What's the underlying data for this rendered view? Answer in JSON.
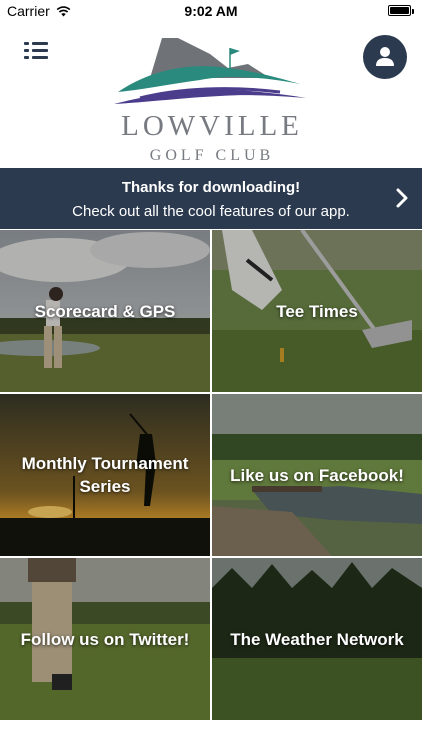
{
  "status_bar": {
    "carrier": "Carrier",
    "time": "9:02 AM",
    "wifi_icon": "wifi-icon",
    "battery_icon": "battery-icon"
  },
  "header": {
    "menu_icon": "list-menu-icon",
    "logo_title": "LOWVILLE",
    "logo_subtitle": "GOLF CLUB",
    "profile_icon": "user-icon",
    "colors": {
      "navy": "#2b3a4f",
      "logo_grey": "#777a80",
      "logo_teal": "#2a8a7e",
      "logo_purple": "#4b3c8c"
    }
  },
  "banner": {
    "title": "Thanks for downloading!",
    "text": "Check out all the cool features of our app.",
    "chevron_icon": "chevron-right-icon"
  },
  "tiles": [
    {
      "label": "Scorecard & GPS"
    },
    {
      "label": "Tee Times"
    },
    {
      "label": "Monthly Tournament Series"
    },
    {
      "label": "Like us on Facebook!"
    },
    {
      "label": "Follow us on Twitter!"
    },
    {
      "label": "The Weather Network"
    }
  ]
}
